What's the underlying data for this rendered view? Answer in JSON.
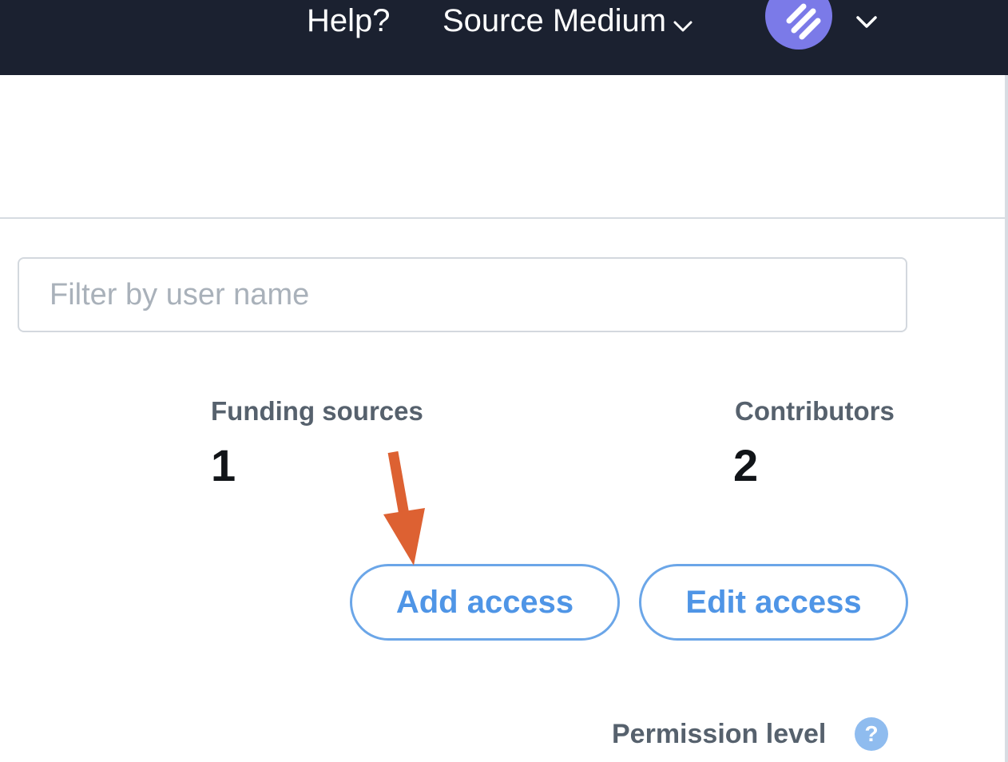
{
  "header": {
    "help_label": "Help?",
    "account_name": "Source Medium",
    "icons": {
      "account_dropdown": "chevron-down-icon",
      "avatar": "logo-stripes-icon",
      "avatar_dropdown": "chevron-down-icon"
    },
    "avatar_color": "#7b7ae8",
    "background_color": "#1b2130"
  },
  "filter": {
    "placeholder": "Filter by user name",
    "value": ""
  },
  "stats": {
    "funding_sources_label": "Funding sources",
    "funding_sources_value": "1",
    "contributors_label": "Contributors",
    "contributors_value": "2"
  },
  "actions": {
    "add_access_label": "Add access",
    "edit_access_label": "Edit access",
    "accent_color": "#4f95e6"
  },
  "annotation": {
    "icon": "arrow-down-icon",
    "color": "#dd6132"
  },
  "permission": {
    "label": "Permission level",
    "help_glyph": "?",
    "help_icon": "question-circle-icon"
  }
}
